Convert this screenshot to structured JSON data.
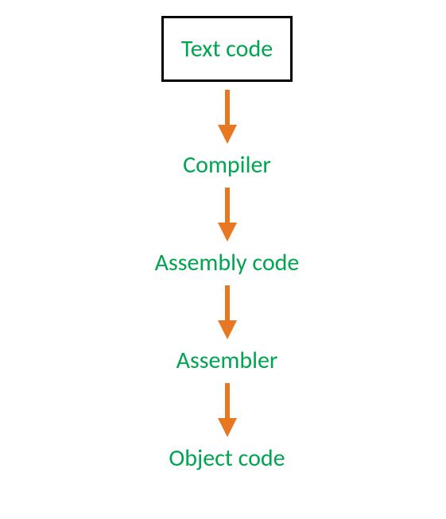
{
  "diagram": {
    "nodes": [
      {
        "label": "Text code",
        "boxed": true
      },
      {
        "label": "Compiler",
        "boxed": false
      },
      {
        "label": "Assembly code",
        "boxed": false
      },
      {
        "label": "Assembler",
        "boxed": false
      },
      {
        "label": "Object code",
        "boxed": false
      }
    ],
    "text_color": "#00a550",
    "arrow_color": "#e87722"
  }
}
